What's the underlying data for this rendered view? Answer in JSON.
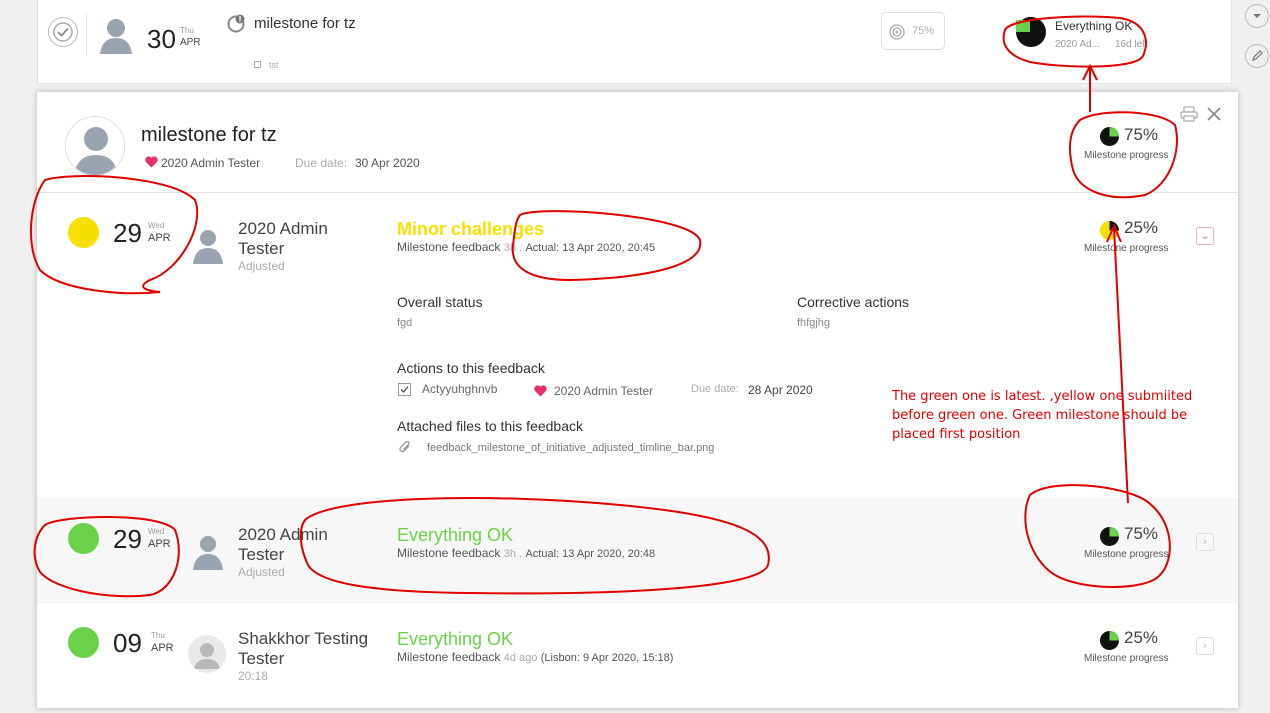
{
  "top_row": {
    "day": "30",
    "weekday": "Thu",
    "month": "APR",
    "title": "milestone for tz",
    "subtask": "tst",
    "percent": "75%",
    "status": "Everything OK",
    "owner_short": "2020 Ad...",
    "days_left": "16d left"
  },
  "panel": {
    "title": "milestone for tz",
    "owner": "2020 Admin Tester",
    "due_label": "Due date:",
    "due_value": "30 Apr 2020",
    "progress_value": "75%",
    "progress_label": "Milestone progress"
  },
  "feedbacks": [
    {
      "day": "29",
      "weekday": "Wed",
      "month": "APR",
      "name": "2020 Admin Tester",
      "role": "Adjusted",
      "status": "Minor challenges",
      "status_color": "#f7e000",
      "type": "Milestone feedback",
      "ago": "3h .",
      "actual": "Actual: 13 Apr 2020, 20:45",
      "progress": "25%",
      "progress_label": "Milestone progress",
      "dot_color": "#f7e000",
      "overall_status_label": "Overall status",
      "overall_status_value": "fgd",
      "corrective_label": "Corrective actions",
      "corrective_value": "fhfgjhg",
      "actions_label": "Actions to this feedback",
      "action_name": "Actyyuhghnvb",
      "action_owner": "2020 Admin Tester",
      "action_due_label": "Due date:",
      "action_due_value": "28 Apr 2020",
      "files_label": "Attached files to this feedback",
      "file_name": "feedback_milestone_of_initiative_adjusted_timline_bar.png"
    },
    {
      "day": "29",
      "weekday": "Wed",
      "month": "APR",
      "name": "2020 Admin Tester",
      "role": "Adjusted",
      "status": "Everything OK",
      "status_color": "#6cd14a",
      "type": "Milestone feedback",
      "ago": "3h .",
      "actual": "Actual: 13 Apr 2020, 20:48",
      "progress": "75%",
      "progress_label": "Milestone progress",
      "dot_color": "#6cd14a"
    },
    {
      "day": "09",
      "weekday": "Thu",
      "month": "APR",
      "name": "Shakkhor Testing Tester",
      "role": "20:18",
      "status": "Everything OK",
      "status_color": "#6cd14a",
      "type": "Milestone feedback",
      "ago": "4d ago",
      "actual": "(Lisbon: 9 Apr 2020, 15:18)",
      "progress": "25%",
      "progress_label": "Milestone progress",
      "dot_color": "#6cd14a"
    }
  ],
  "annotation": "The green one is latest. ,yellow one submiited before green one. Green milestone should be placed first position",
  "colors": {
    "green": "#6cd14a",
    "yellow": "#f7e000",
    "red_annotation": "#e00000",
    "pink_heart": "#e8316b"
  },
  "icons": [
    "check-circle-icon",
    "avatar-icon",
    "alert-clock-icon",
    "target-icon",
    "chevron-down-icon",
    "pencil-icon",
    "print-icon",
    "close-icon",
    "heart-icon",
    "checkbox-icon",
    "paperclip-icon",
    "chevron-right-icon"
  ]
}
